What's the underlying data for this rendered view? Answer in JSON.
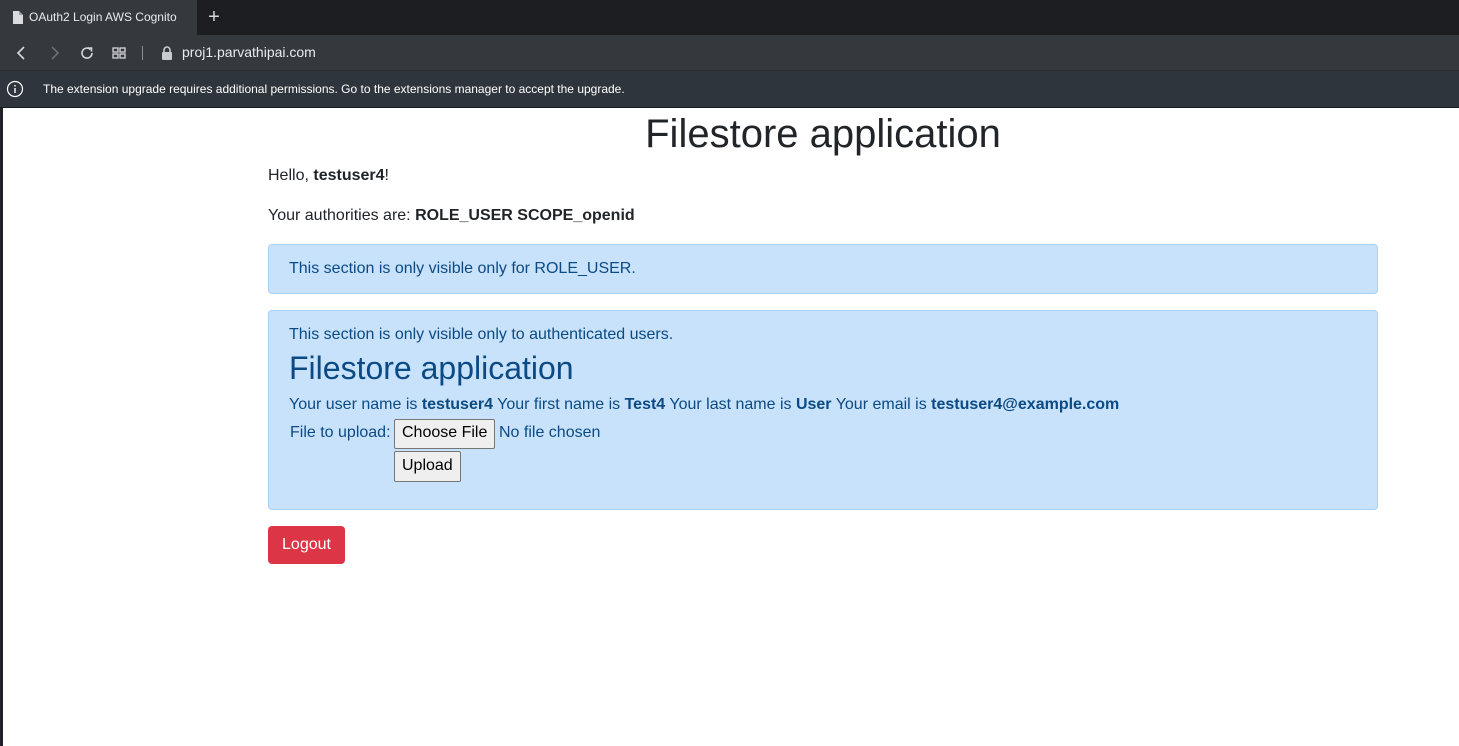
{
  "browser": {
    "tab_title": "OAuth2 Login AWS Cognito",
    "url": "proj1.parvathipai.com",
    "infobar_message": "The extension upgrade requires additional permissions. Go to the extensions manager to accept the upgrade."
  },
  "page": {
    "title": "Filestore application",
    "hello_prefix": "Hello, ",
    "username": "testuser4",
    "hello_suffix": "!",
    "authorities_prefix": "Your authorities are: ",
    "authorities": "ROLE_USER SCOPE_openid",
    "role_section_text": "This section is only visible only for ROLE_USER.",
    "auth_section_text": "This section is only visible only to authenticated users.",
    "auth_section_heading": "Filestore application",
    "user_name_label": "Your user name is ",
    "user_name": "testuser4",
    "first_name_label": " Your first name is ",
    "first_name": "Test4",
    "last_name_label": " Your last name is ",
    "last_name": "User",
    "email_label": " Your email is ",
    "email": "testuser4@example.com",
    "file_label": "File to upload:",
    "choose_file_label": "Choose File",
    "no_file_text": "No file chosen",
    "upload_label": "Upload",
    "logout_label": "Logout"
  },
  "colors": {
    "alert_bg": "#c8e2fb",
    "alert_text": "#0b4a84",
    "logout_bg": "#dc3545"
  }
}
